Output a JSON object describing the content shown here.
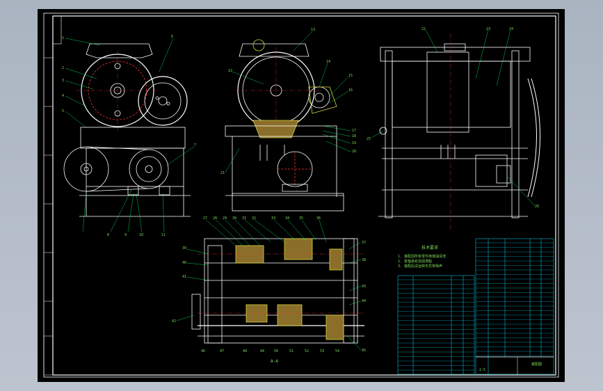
{
  "drawing": {
    "background": "#000000",
    "colors": {
      "frame": "#ffffff",
      "geometry": "#ffffff",
      "section": "#d8d840",
      "center": "#ff3030",
      "table": "#00e0ff",
      "leader": "#00ff66",
      "text": "#7fdc5a"
    },
    "view_front": {
      "balloons": [
        "1",
        "2",
        "3",
        "4",
        "5",
        "6",
        "7",
        "8",
        "9",
        "10",
        "11"
      ]
    },
    "view_side": {
      "balloons": [
        "12",
        "13",
        "14",
        "15",
        "16",
        "17",
        "18",
        "19",
        "20",
        "21"
      ]
    },
    "view_right": {
      "balloons": [
        "22",
        "23",
        "24",
        "25",
        "26"
      ]
    },
    "view_section": {
      "balloons_top": [
        "27",
        "28",
        "29",
        "30",
        "31",
        "32",
        "33",
        "34",
        "35",
        "36",
        "37",
        "38"
      ],
      "balloons_bottom": [
        "39",
        "40",
        "41",
        "42",
        "43",
        "44",
        "45",
        "46",
        "47",
        "48",
        "49",
        "50",
        "51",
        "52",
        "53",
        "54"
      ],
      "section_label": "A-A"
    },
    "notes": {
      "title": "技术要求",
      "lines": [
        "1. 装配前所有零件用煤油清洗",
        "2. 各轴承处加润滑脂",
        "3. 装配后试运转无异常噪声"
      ]
    },
    "title_block": {
      "name": "装配图",
      "scale": "1:5"
    }
  }
}
